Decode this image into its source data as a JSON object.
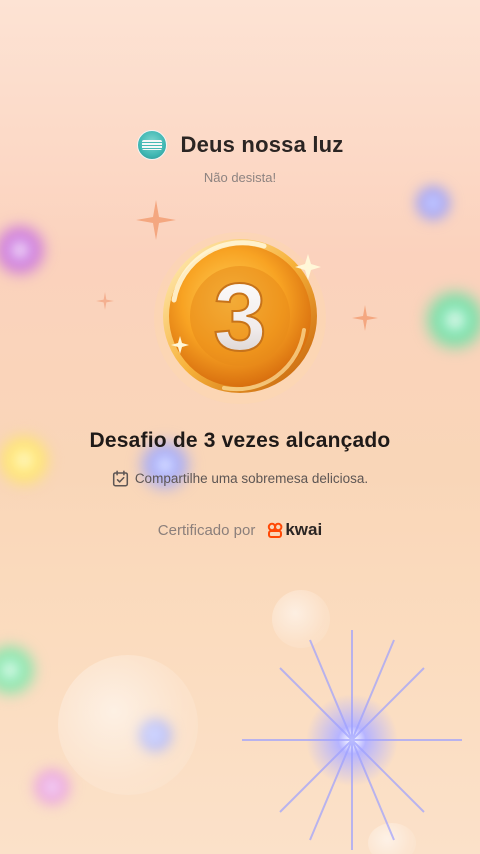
{
  "header": {
    "title": "Deus nossa luz",
    "subtitle": "Não desista!"
  },
  "medal": {
    "number": "3"
  },
  "achievement": {
    "title": "Desafio de 3 vezes alcançado",
    "task": "Compartilhe uma sobremesa deliciosa."
  },
  "certification": {
    "label": "Certificado por",
    "brand": "kwai",
    "brand_color": "#ff4906"
  },
  "colors": {
    "medal_gold": "#f6a21d",
    "text_primary": "#2b2523",
    "text_secondary": "#8d8380"
  },
  "icons": {
    "avatar": "avatar-image",
    "task": "calendar-check-icon",
    "brand": "kwai-logo-icon"
  }
}
